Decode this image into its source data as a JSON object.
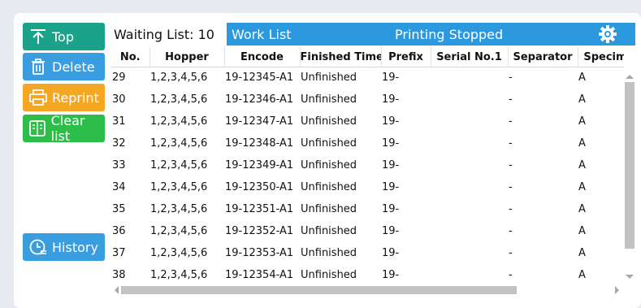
{
  "sidebar": {
    "top_label": "Top",
    "delete_label": "Delete",
    "reprint_label": "Reprint",
    "clear_label": "Clear list",
    "history_label": "History"
  },
  "waiting": {
    "label": "Waiting List: 10"
  },
  "worklist": {
    "title": "Work List",
    "status": "Printing Stopped"
  },
  "table": {
    "columns": [
      "No.",
      "Hopper",
      "Encode",
      "Finished Time",
      "Prefix",
      "Serial No.1",
      "Separator",
      "Specimen"
    ],
    "rows": [
      [
        "29",
        "1,2,3,4,5,6",
        "19-12345-A1",
        "Unfinished",
        "19-",
        "",
        "-",
        "A"
      ],
      [
        "30",
        "1,2,3,4,5,6",
        "19-12346-A1",
        "Unfinished",
        "19-",
        "",
        "-",
        "A"
      ],
      [
        "31",
        "1,2,3,4,5,6",
        "19-12347-A1",
        "Unfinished",
        "19-",
        "",
        "-",
        "A"
      ],
      [
        "32",
        "1,2,3,4,5,6",
        "19-12348-A1",
        "Unfinished",
        "19-",
        "",
        "-",
        "A"
      ],
      [
        "33",
        "1,2,3,4,5,6",
        "19-12349-A1",
        "Unfinished",
        "19-",
        "",
        "-",
        "A"
      ],
      [
        "34",
        "1,2,3,4,5,6",
        "19-12350-A1",
        "Unfinished",
        "19-",
        "",
        "-",
        "A"
      ],
      [
        "35",
        "1,2,3,4,5,6",
        "19-12351-A1",
        "Unfinished",
        "19-",
        "",
        "-",
        "A"
      ],
      [
        "36",
        "1,2,3,4,5,6",
        "19-12352-A1",
        "Unfinished",
        "19-",
        "",
        "-",
        "A"
      ],
      [
        "37",
        "1,2,3,4,5,6",
        "19-12353-A1",
        "Unfinished",
        "19-",
        "",
        "-",
        "A"
      ],
      [
        "38",
        "1,2,3,4,5,6",
        "19-12354-A1",
        "Unfinished",
        "19-",
        "",
        "-",
        "A"
      ]
    ]
  },
  "colors": {
    "top": "#1aa38a",
    "delete": "#3a9de0",
    "reprint": "#f5a623",
    "clear": "#2dbd49",
    "history": "#3a9de0",
    "worklist_bar": "#2c98de"
  }
}
